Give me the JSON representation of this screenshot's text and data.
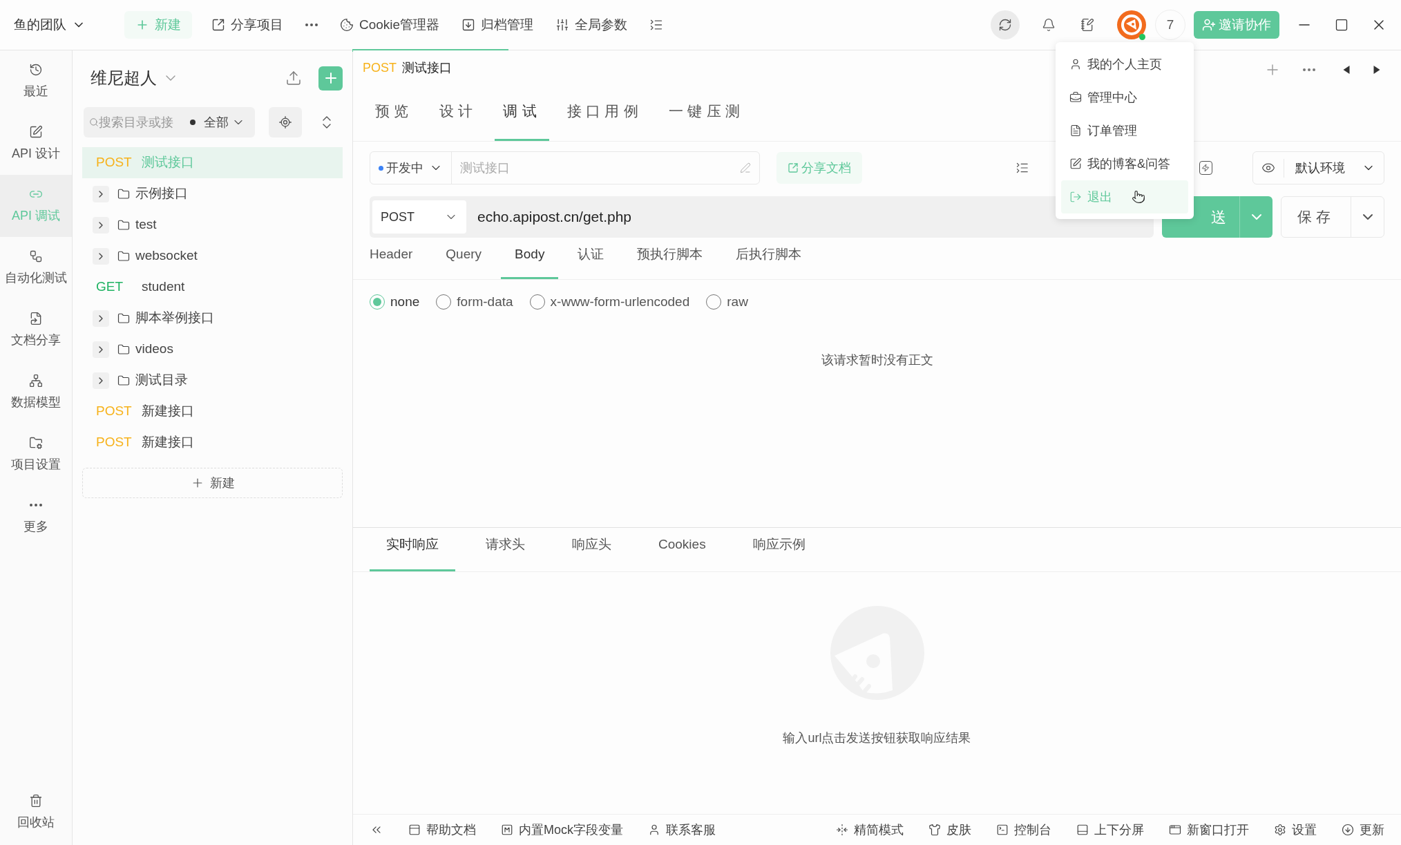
{
  "top_bar": {
    "team": "鱼的团队",
    "new_button": "新建",
    "tools": [
      {
        "kind": "share",
        "label": "分享项目"
      },
      {
        "kind": "more"
      },
      {
        "kind": "cookie",
        "label": "Cookie管理器"
      },
      {
        "kind": "archive",
        "label": "归档管理"
      },
      {
        "kind": "params",
        "label": "全局参数"
      },
      {
        "kind": "collapse"
      }
    ],
    "avatar": {
      "online": true
    },
    "count_badge": "7",
    "invite_button": "邀请协作"
  },
  "nav": {
    "items": [
      {
        "kind": "recent",
        "label": "最近",
        "selected": false
      },
      {
        "kind": "design",
        "label": "API 设计",
        "selected": false
      },
      {
        "kind": "debug",
        "label": "API 调试",
        "selected": true
      },
      {
        "kind": "auto",
        "label": "自动化测试",
        "selected": false
      },
      {
        "kind": "docs",
        "label": "文档分享",
        "selected": false
      },
      {
        "kind": "model",
        "label": "数据模型",
        "selected": false
      },
      {
        "kind": "settings",
        "label": "项目设置",
        "selected": false
      },
      {
        "kind": "more",
        "label": "更多",
        "selected": false
      }
    ],
    "trash": "回收站"
  },
  "tree": {
    "project": "维尼超人",
    "search": {
      "placeholder": "搜索目录或接"
    },
    "filter": "全部",
    "items": [
      {
        "kind": "api",
        "method": "POST",
        "name": "测试接口",
        "selected": true
      },
      {
        "kind": "folder",
        "name": "示例接口",
        "expanded": false
      },
      {
        "kind": "folder",
        "name": "test",
        "expanded": false
      },
      {
        "kind": "folder",
        "name": "websocket",
        "expanded": false
      },
      {
        "kind": "api",
        "method": "GET",
        "name": "student",
        "selected": false
      },
      {
        "kind": "folder",
        "name": "脚本举例接口",
        "expanded": false
      },
      {
        "kind": "folder",
        "name": "videos",
        "expanded": false
      },
      {
        "kind": "folder",
        "name": "测试目录",
        "expanded": false
      },
      {
        "kind": "api",
        "method": "POST",
        "name": "新建接口",
        "selected": false
      },
      {
        "kind": "api",
        "method": "POST",
        "name": "新建接口",
        "selected": false
      }
    ],
    "new_button": "新建"
  },
  "open_tab": {
    "method": "POST",
    "name": "测试接口"
  },
  "doc_tabs": [
    {
      "label": "预览",
      "selected": false
    },
    {
      "label": "设计",
      "selected": false
    },
    {
      "label": "调试",
      "selected": true
    },
    {
      "label": "接口用例",
      "selected": false
    },
    {
      "label": "一键压测",
      "selected": false
    }
  ],
  "env_row": {
    "status": "开发中",
    "name_field": {
      "placeholder": "测试接口"
    },
    "share_button": "分享文档",
    "environment": "默认环境"
  },
  "request": {
    "method": "POST",
    "url": "echo.apipost.cn/get.php",
    "send_button": "送",
    "save_button": "保存"
  },
  "request_tabs": [
    {
      "label": "Header",
      "selected": false
    },
    {
      "label": "Query",
      "selected": false
    },
    {
      "label": "Body",
      "selected": true
    },
    {
      "label": "认证",
      "selected": false
    },
    {
      "label": "预执行脚本",
      "selected": false
    },
    {
      "label": "后执行脚本",
      "selected": false
    }
  ],
  "body_types": [
    {
      "label": "none",
      "selected": true
    },
    {
      "label": "form-data",
      "selected": false
    },
    {
      "label": "x-www-form-urlencoded",
      "selected": false
    },
    {
      "label": "raw",
      "selected": false
    }
  ],
  "body_empty": "该请求暂时没有正文",
  "response_tabs": [
    {
      "label": "实时响应",
      "selected": true
    },
    {
      "label": "请求头",
      "selected": false
    },
    {
      "label": "响应头",
      "selected": false
    },
    {
      "label": "Cookies",
      "selected": false
    },
    {
      "label": "响应示例",
      "selected": false
    }
  ],
  "response_empty": "输入url点击发送按钮获取响应结果",
  "status_bar": [
    {
      "kind": "help",
      "label": "帮助文档"
    },
    {
      "kind": "mock",
      "label": "内置Mock字段变量"
    },
    {
      "kind": "support",
      "label": "联系客服"
    },
    {
      "kind": "compact",
      "label": "精简模式"
    },
    {
      "kind": "skin",
      "label": "皮肤"
    },
    {
      "kind": "console",
      "label": "控制台"
    },
    {
      "kind": "split",
      "label": "上下分屏"
    },
    {
      "kind": "window",
      "label": "新窗口打开"
    },
    {
      "kind": "settings",
      "label": "设置"
    },
    {
      "kind": "update",
      "label": "更新"
    }
  ],
  "user_menu": [
    {
      "kind": "profile",
      "label": "我的个人主页",
      "selected": false
    },
    {
      "kind": "admin",
      "label": "管理中心",
      "selected": false
    },
    {
      "kind": "orders",
      "label": "订单管理",
      "selected": false
    },
    {
      "kind": "blog",
      "label": "我的博客&问答",
      "selected": false
    },
    {
      "kind": "logout",
      "label": "退出",
      "selected": true
    }
  ]
}
